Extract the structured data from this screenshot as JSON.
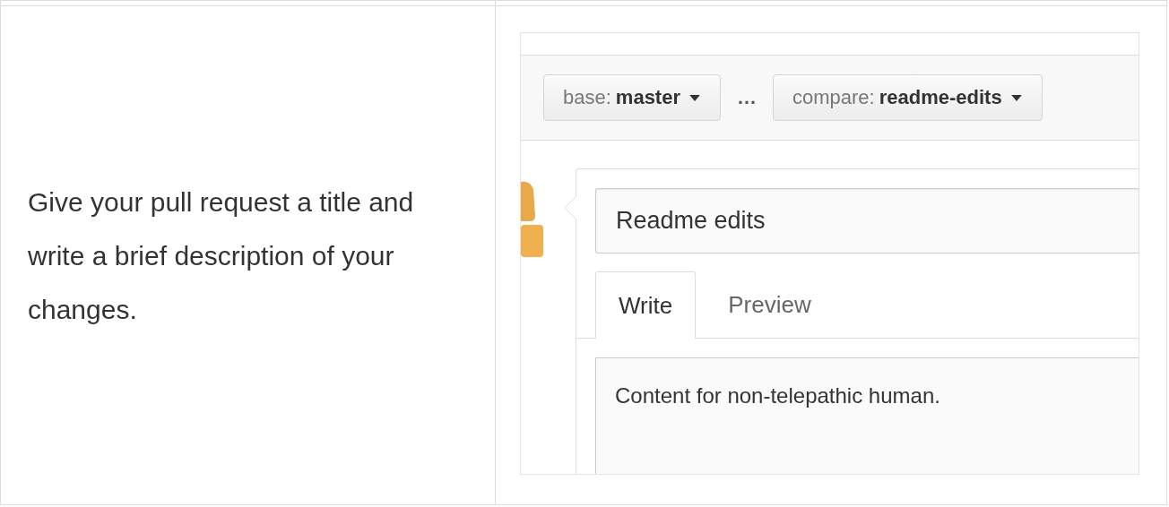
{
  "intro": "Give your pull request a title and write a brief description of your changes.",
  "branch_bar": {
    "base": {
      "label": "base:",
      "branch": "master"
    },
    "separator": "…",
    "compare": {
      "label": "compare:",
      "branch": "readme-edits"
    }
  },
  "title_field": {
    "value": "Readme edits"
  },
  "tabs": [
    {
      "label": "Write",
      "selected": true
    },
    {
      "label": "Preview",
      "selected": false
    }
  ],
  "body_field": {
    "value": "Content for non-telepathic human."
  }
}
